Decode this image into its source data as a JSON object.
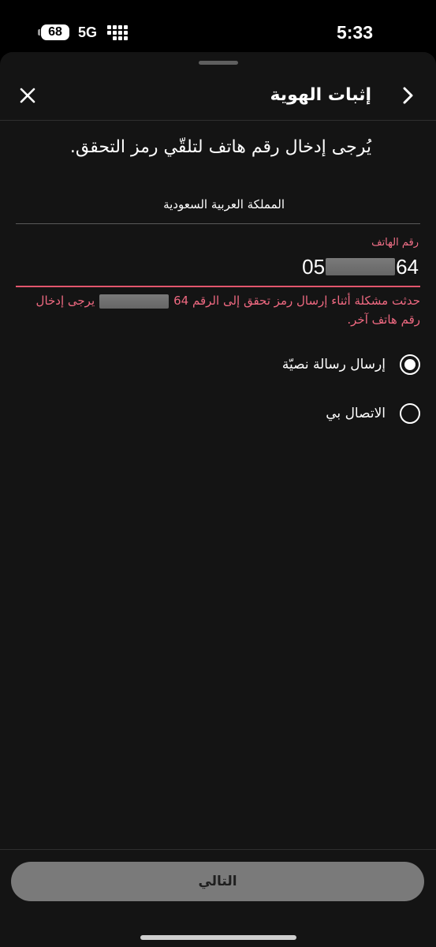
{
  "status_bar": {
    "battery": "68",
    "network": "5G",
    "time": "5:33"
  },
  "header": {
    "title": "إثبات الهوية",
    "close_icon": "close-icon",
    "back_icon": "chevron-right-icon"
  },
  "instructions": "يُرجى إدخال رقم هاتف لتلقّي رمز التحقق.",
  "country": {
    "value": "المملكة العربية السعودية"
  },
  "phone": {
    "label": "رقم الهاتف",
    "prefix": "05",
    "suffix": "64"
  },
  "error": {
    "part1": "حدثت مشكلة أثناء إرسال رمز تحقق إلى الرقم 64",
    "part2": "يرجى إدخال رقم هاتف آخر."
  },
  "options": [
    {
      "label": "إرسال رسالة نصيّة",
      "selected": true
    },
    {
      "label": "الاتصال بي",
      "selected": false
    }
  ],
  "footer": {
    "next_label": "التالي"
  },
  "colors": {
    "accent_error": "#e2566d",
    "background": "#141414",
    "button_disabled": "#7a7a7a"
  }
}
